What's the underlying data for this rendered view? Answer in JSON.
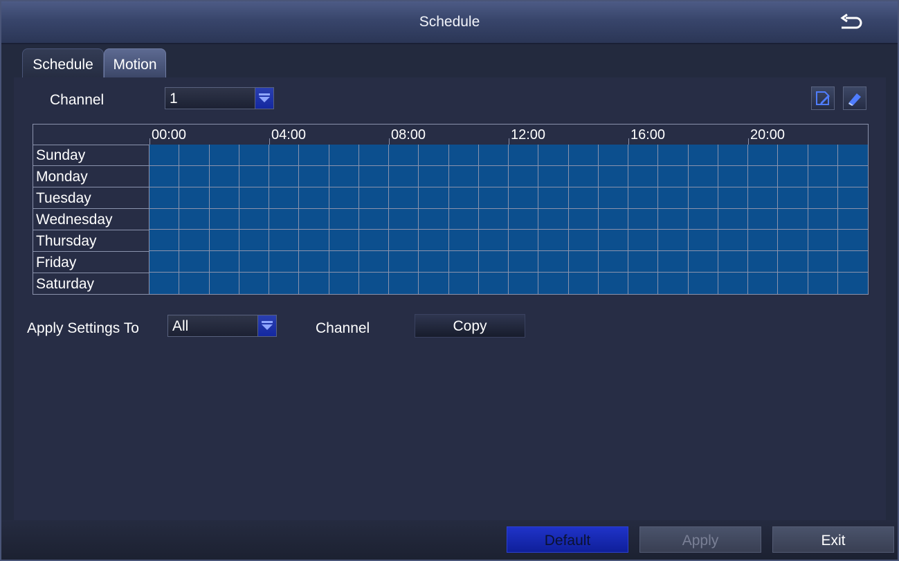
{
  "window": {
    "title": "Schedule"
  },
  "tabs": [
    {
      "label": "Schedule",
      "active": false
    },
    {
      "label": "Motion",
      "active": true
    }
  ],
  "channel": {
    "label": "Channel",
    "value": "1"
  },
  "tools": [
    {
      "name": "edit-icon"
    },
    {
      "name": "eraser-icon"
    }
  ],
  "schedule_grid": {
    "hours": [
      "00:00",
      "04:00",
      "08:00",
      "12:00",
      "16:00",
      "20:00"
    ],
    "days": [
      "Sunday",
      "Monday",
      "Tuesday",
      "Wednesday",
      "Thursday",
      "Friday",
      "Saturday"
    ],
    "all_hours_selected": true,
    "cell_color": "#0c4f8e"
  },
  "apply_settings": {
    "label": "Apply Settings To",
    "value": "All",
    "channel_label": "Channel",
    "copy_label": "Copy"
  },
  "footer": {
    "default_label": "Default",
    "apply_label": "Apply",
    "exit_label": "Exit"
  },
  "colors": {
    "accent": "#1f33c8",
    "background": "#232a3e"
  }
}
